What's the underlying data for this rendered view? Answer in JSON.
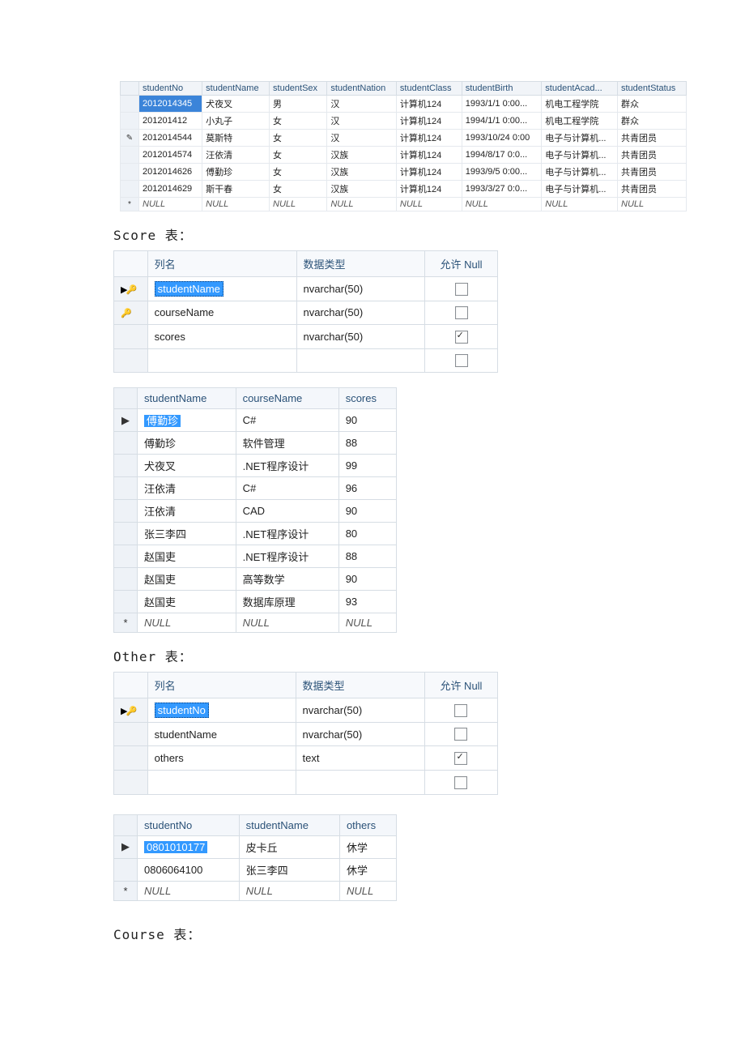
{
  "labels": {
    "score": "Score 表：",
    "other": "Other 表：",
    "course": "Course 表："
  },
  "studentTable": {
    "headers": [
      "studentNo",
      "studentName",
      "studentSex",
      "studentNation",
      "studentClass",
      "studentBirth",
      "studentAcad...",
      "studentStatus"
    ],
    "rows": [
      {
        "gutter": "",
        "sel": true,
        "cells": [
          "2012014345",
          "犬夜叉",
          "男",
          "汉",
          "计算机124",
          "1993/1/1 0:00...",
          "机电工程学院",
          "群众"
        ]
      },
      {
        "gutter": "",
        "cells": [
          "201201412",
          "小丸子",
          "女",
          "汉",
          "计算机124",
          "1994/1/1 0:00...",
          "机电工程学院",
          "群众"
        ]
      },
      {
        "gutter": "✎",
        "cells": [
          "2012014544",
          "莫斯特",
          "女",
          "汉",
          "计算机124",
          "1993/10/24 0:00",
          "电子与计算机...",
          "共青团员"
        ]
      },
      {
        "gutter": "",
        "cells": [
          "2012014574",
          "汪依清",
          "女",
          "汉族",
          "计算机124",
          "1994/8/17 0:0...",
          "电子与计算机...",
          "共青团员"
        ]
      },
      {
        "gutter": "",
        "cells": [
          "2012014626",
          "傅勤珍",
          "女",
          "汉族",
          "计算机124",
          "1993/9/5 0:00...",
          "电子与计算机...",
          "共青团员"
        ]
      },
      {
        "gutter": "",
        "cells": [
          "2012014629",
          "斯干春",
          "女",
          "汉族",
          "计算机124",
          "1993/3/27 0:0...",
          "电子与计算机...",
          "共青团员"
        ]
      },
      {
        "gutter": "*",
        "null": true,
        "cells": [
          "NULL",
          "NULL",
          "NULL",
          "NULL",
          "NULL",
          "NULL",
          "NULL",
          "NULL"
        ]
      }
    ]
  },
  "schemaHeaders": {
    "name": "列名",
    "type": "数据类型",
    "null": "允许 Null"
  },
  "scoreSchema": [
    {
      "key": "pk-sel",
      "name": "studentName",
      "type": "nvarchar(50)",
      "null": false,
      "selected": true
    },
    {
      "key": "pk",
      "name": "courseName",
      "type": "nvarchar(50)",
      "null": false
    },
    {
      "key": "",
      "name": "scores",
      "type": "nvarchar(50)",
      "null": true
    },
    {
      "key": "",
      "name": "",
      "type": "",
      "null": false,
      "blank": true
    }
  ],
  "scoreData": {
    "headers": [
      "studentName",
      "courseName",
      "scores"
    ],
    "rows": [
      {
        "gutter": "▶",
        "sel": true,
        "cells": [
          "傅勤珍",
          "C#",
          "90"
        ]
      },
      {
        "gutter": "",
        "cells": [
          "傅勤珍",
          "软件管理",
          "88"
        ]
      },
      {
        "gutter": "",
        "cells": [
          "犬夜叉",
          ".NET程序设计",
          "99"
        ]
      },
      {
        "gutter": "",
        "cells": [
          "汪依清",
          "C#",
          "96"
        ]
      },
      {
        "gutter": "",
        "cells": [
          "汪依清",
          "CAD",
          "90"
        ]
      },
      {
        "gutter": "",
        "cells": [
          "张三李四",
          ".NET程序设计",
          "80"
        ]
      },
      {
        "gutter": "",
        "cells": [
          "赵国吏",
          ".NET程序设计",
          "88"
        ]
      },
      {
        "gutter": "",
        "cells": [
          "赵国吏",
          "高等数学",
          "90"
        ]
      },
      {
        "gutter": "",
        "cells": [
          "赵国吏",
          "数据库原理",
          "93"
        ]
      },
      {
        "gutter": "*",
        "null": true,
        "cells": [
          "NULL",
          "NULL",
          "NULL"
        ]
      }
    ]
  },
  "otherSchema": [
    {
      "key": "pk-sel",
      "name": "studentNo",
      "type": "nvarchar(50)",
      "null": false,
      "selected": true
    },
    {
      "key": "",
      "name": "studentName",
      "type": "nvarchar(50)",
      "null": false
    },
    {
      "key": "",
      "name": "others",
      "type": "text",
      "null": true
    },
    {
      "key": "",
      "name": "",
      "type": "",
      "null": false,
      "blank": true
    }
  ],
  "otherData": {
    "headers": [
      "studentNo",
      "studentName",
      "others"
    ],
    "rows": [
      {
        "gutter": "▶",
        "sel": true,
        "cells": [
          "0801010177",
          "皮卡丘",
          "休学"
        ]
      },
      {
        "gutter": "",
        "cells": [
          "0806064100",
          "张三李四",
          "休学"
        ]
      },
      {
        "gutter": "*",
        "null": true,
        "cells": [
          "NULL",
          "NULL",
          "NULL"
        ]
      }
    ]
  }
}
